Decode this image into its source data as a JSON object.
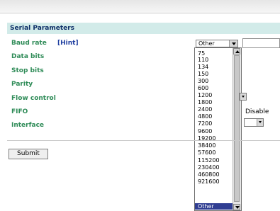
{
  "section": {
    "title": "Serial Parameters"
  },
  "fields": {
    "baud_rate": "Baud rate",
    "hint": "[Hint]",
    "data_bits": "Data bits",
    "stop_bits": "Stop bits",
    "parity": "Parity",
    "flow_control": "Flow control",
    "fifo": "FIFO",
    "interface": "Interface"
  },
  "baud_select": {
    "selected": "Other"
  },
  "baud_options": [
    "75",
    "110",
    "134",
    "150",
    "300",
    "600",
    "1200",
    "1800",
    "2400",
    "4800",
    "7200",
    "9600",
    "19200",
    "38400",
    "57600",
    "115200",
    "230400",
    "460800",
    "921600",
    "Other"
  ],
  "fifo_value": "Disable",
  "buttons": {
    "submit": "Submit"
  },
  "icons": {
    "dropdown": "chevron-down-icon",
    "scroll_up": "arrow-up-icon",
    "scroll_down": "arrow-down-icon"
  }
}
